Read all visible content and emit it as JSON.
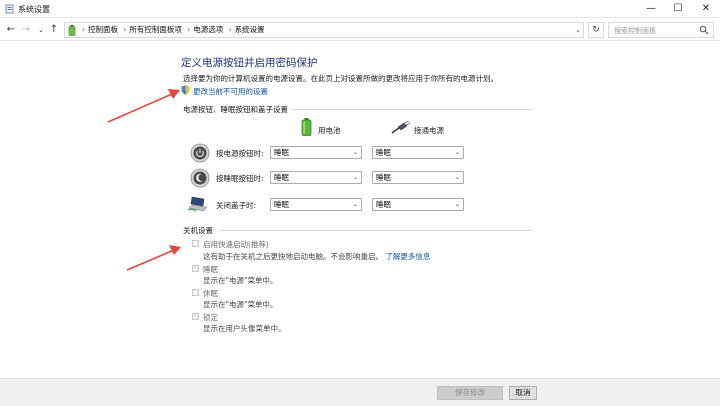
{
  "window": {
    "title": "系统设置",
    "controls": {
      "minimize": "—",
      "maximize": "☐",
      "close": "✕"
    }
  },
  "nav": {
    "back": "←",
    "forward": "→",
    "recent": "⌄",
    "up": "↑",
    "breadcrumb": [
      "控制面板",
      "所有控制面板项",
      "电源选项",
      "系统设置"
    ],
    "address_dropdown": "⌄",
    "refresh": "↻",
    "search_placeholder": "搜索控制面板"
  },
  "page": {
    "title": "定义电源按钮并启用密码保护",
    "description": "选择要为你的计算机设置的电源设置。在此页上对设置所做的更改将应用于你所有的电源计划。",
    "change_link": "更改当前不可用的设置"
  },
  "power_section": {
    "title": "电源按钮、睡眠按钮和盖子设置",
    "columns": {
      "battery": "用电池",
      "plugged": "接通电源"
    },
    "rows": [
      {
        "label": "按电源按钮时:",
        "battery": "睡眠",
        "plugged": "睡眠"
      },
      {
        "label": "按睡眠按钮时:",
        "battery": "睡眠",
        "plugged": "睡眠"
      },
      {
        "label": "关闭盖子时:",
        "battery": "睡眠",
        "plugged": "睡眠"
      }
    ]
  },
  "shutdown_section": {
    "title": "关机设置",
    "options": [
      {
        "label": "启用快速启动(推荐)",
        "checked": false,
        "desc": "这有助于在关机之后更快地启动电脑。不会影响重启。",
        "link": "了解更多信息"
      },
      {
        "label": "睡眠",
        "checked": true,
        "desc": "显示在\"电源\"菜单中。"
      },
      {
        "label": "休眠",
        "checked": false,
        "desc": "显示在\"电源\"菜单中。"
      },
      {
        "label": "锁定",
        "checked": true,
        "desc": "显示在用户头像菜单中。"
      }
    ]
  },
  "footer": {
    "save": "保存修改",
    "cancel": "取消"
  },
  "colors": {
    "title_blue": "#1e3287",
    "link_blue": "#0a56b6",
    "annotation_red": "#e8443a"
  }
}
